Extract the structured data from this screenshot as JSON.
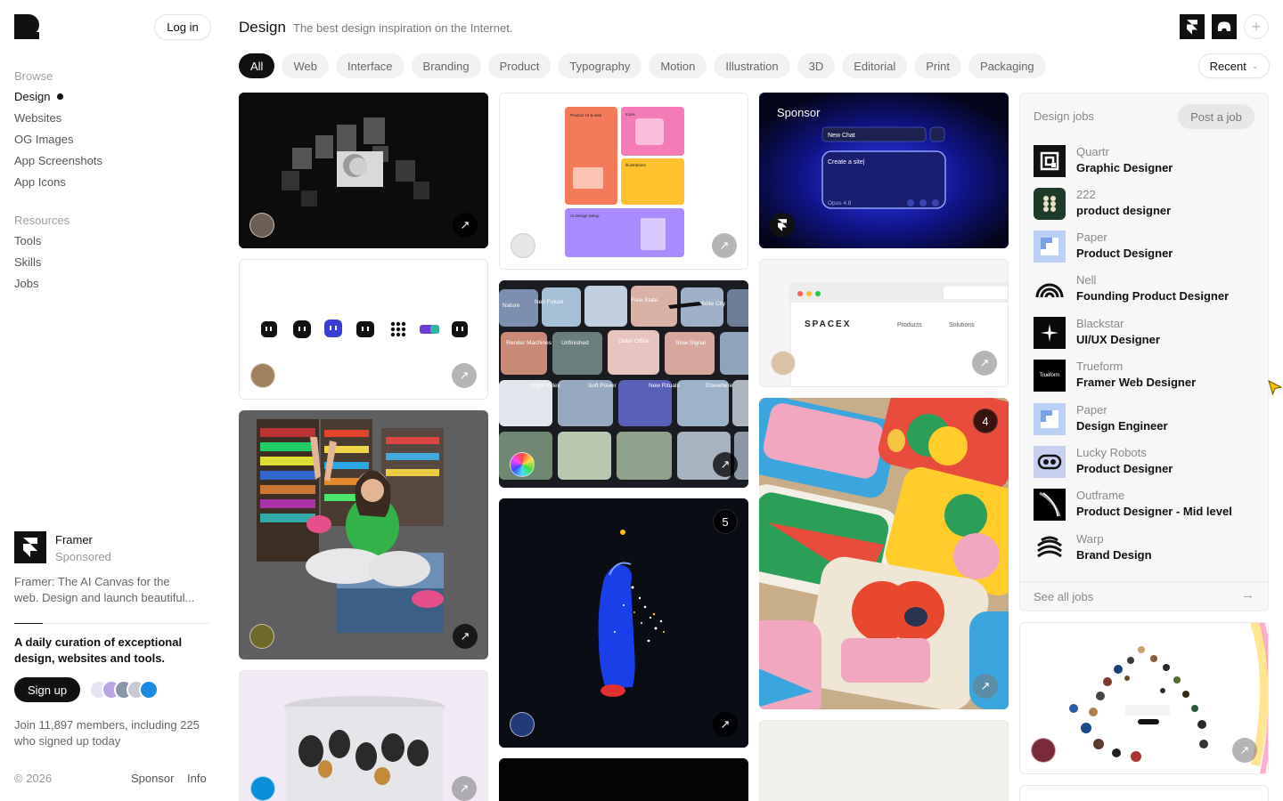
{
  "sidebar": {
    "login_label": "Log in",
    "browse_title": "Browse",
    "browse_items": [
      "Design",
      "Websites",
      "OG Images",
      "App Screenshots",
      "App Icons"
    ],
    "resources_title": "Resources",
    "resource_items": [
      "Tools",
      "Skills",
      "Jobs"
    ],
    "sponsor": {
      "name": "Framer",
      "tag": "Sponsored",
      "description_line1": "Framer: The AI Canvas for the",
      "description_line2": " web. Design and launch beautiful..."
    },
    "tagline": "A daily curation of exceptional design, websites and tools.",
    "signup_label": "Sign up",
    "members_text": "Join 11,897 members, including 225 who signed up today",
    "copyright": "© 2026",
    "footer_links": [
      "Sponsor",
      "Info"
    ]
  },
  "header": {
    "title": "Design",
    "subtitle": "The best design inspiration on the Internet."
  },
  "filters": {
    "chips": [
      "All",
      "Web",
      "Interface",
      "Branding",
      "Product",
      "Typography",
      "Motion",
      "Illustration",
      "3D",
      "Editorial",
      "Print",
      "Packaging"
    ],
    "active_chip": "All",
    "sort_label": "Recent"
  },
  "cards": {
    "sponsor_label": "Sponsor",
    "chat_title": "New Chat",
    "chat_input": "Create a site|",
    "chat_model": "Opus 4.8",
    "spacex_logo": "SPACEX",
    "spacex_nav": [
      "Products",
      "Solutions"
    ],
    "cards_panel_titles": [
      "Product UI & web",
      "Icons",
      "Illustrations",
      "AI Design Setup"
    ],
    "tile_labels": [
      "Nature",
      "Neo Future",
      "Outer Office",
      "Free State",
      "Infinite City",
      "Render Machines",
      "Unfinished",
      "Slow Signal",
      "Night Index",
      "Soft Power",
      "New Rituals",
      "Elsewhere"
    ],
    "badge_motion": "5",
    "badge_packaging": "4"
  },
  "jobs": {
    "title": "Design jobs",
    "post_label": "Post a job",
    "list": [
      {
        "company": "Quartr",
        "title": "Graphic Designer"
      },
      {
        "company": "222",
        "title": "product designer"
      },
      {
        "company": "Paper",
        "title": "Product Designer"
      },
      {
        "company": "Nell",
        "title": "Founding Product Designer"
      },
      {
        "company": "Blackstar",
        "title": "UI/UX Designer"
      },
      {
        "company": "Trueform",
        "title": "Framer Web Designer"
      },
      {
        "company": "Paper",
        "title": "Design Engineer"
      },
      {
        "company": "Lucky Robots",
        "title": "Product Designer"
      },
      {
        "company": "Outframe",
        "title": "Product Designer - Mid level"
      },
      {
        "company": "Warp",
        "title": "Brand Design"
      }
    ],
    "see_all": "See all jobs",
    "trueform_logo_text": "Trueform"
  },
  "colors": {
    "accent": "#111111",
    "chip_bg": "#f2f2f2",
    "cursor": "#f5c400"
  }
}
